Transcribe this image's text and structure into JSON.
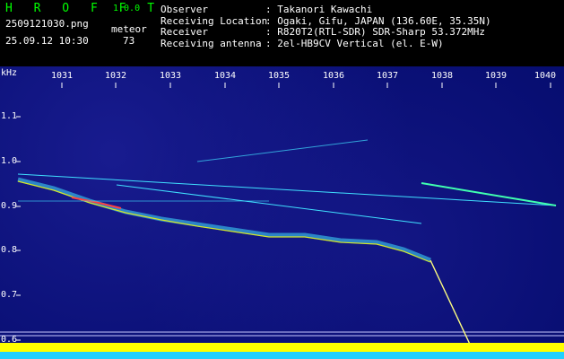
{
  "header": {
    "app_title": "H R O F F T",
    "app_version": "1.0.0",
    "file_name": "2509121030.png",
    "timestamp": "25.09.12 10:30",
    "meteor_label": "meteor",
    "meteor_count": "73",
    "info": [
      {
        "key": "Observer",
        "value": ": Takanori Kawachi"
      },
      {
        "key": "Receiving Location",
        "value": ": Ogaki, Gifu, JAPAN (136.60E, 35.35N)"
      },
      {
        "key": "Receiver",
        "value": ": R820T2(RTL-SDR) SDR-Sharp 53.372MHz"
      },
      {
        "key": "Receiving antenna",
        "value": ": 2el-HB9CV Vertical (el. E-W)"
      }
    ]
  },
  "axes": {
    "y_unit": "kHz",
    "x_ticks": [
      "1031",
      "1032",
      "1033",
      "1034",
      "1035",
      "1036",
      "1037",
      "1038",
      "1039",
      "1040"
    ],
    "y_ticks": [
      "1.1",
      "1.0",
      "0.9",
      "0.8",
      "0.7",
      "0.6"
    ]
  },
  "colors": {
    "background": "#050c6e",
    "header_text": "#ffffff",
    "title_green": "#00ff00",
    "signal_cyan": "#40e0ff",
    "signal_yellow": "#ffff00",
    "signal_red": "#ff4040"
  }
}
